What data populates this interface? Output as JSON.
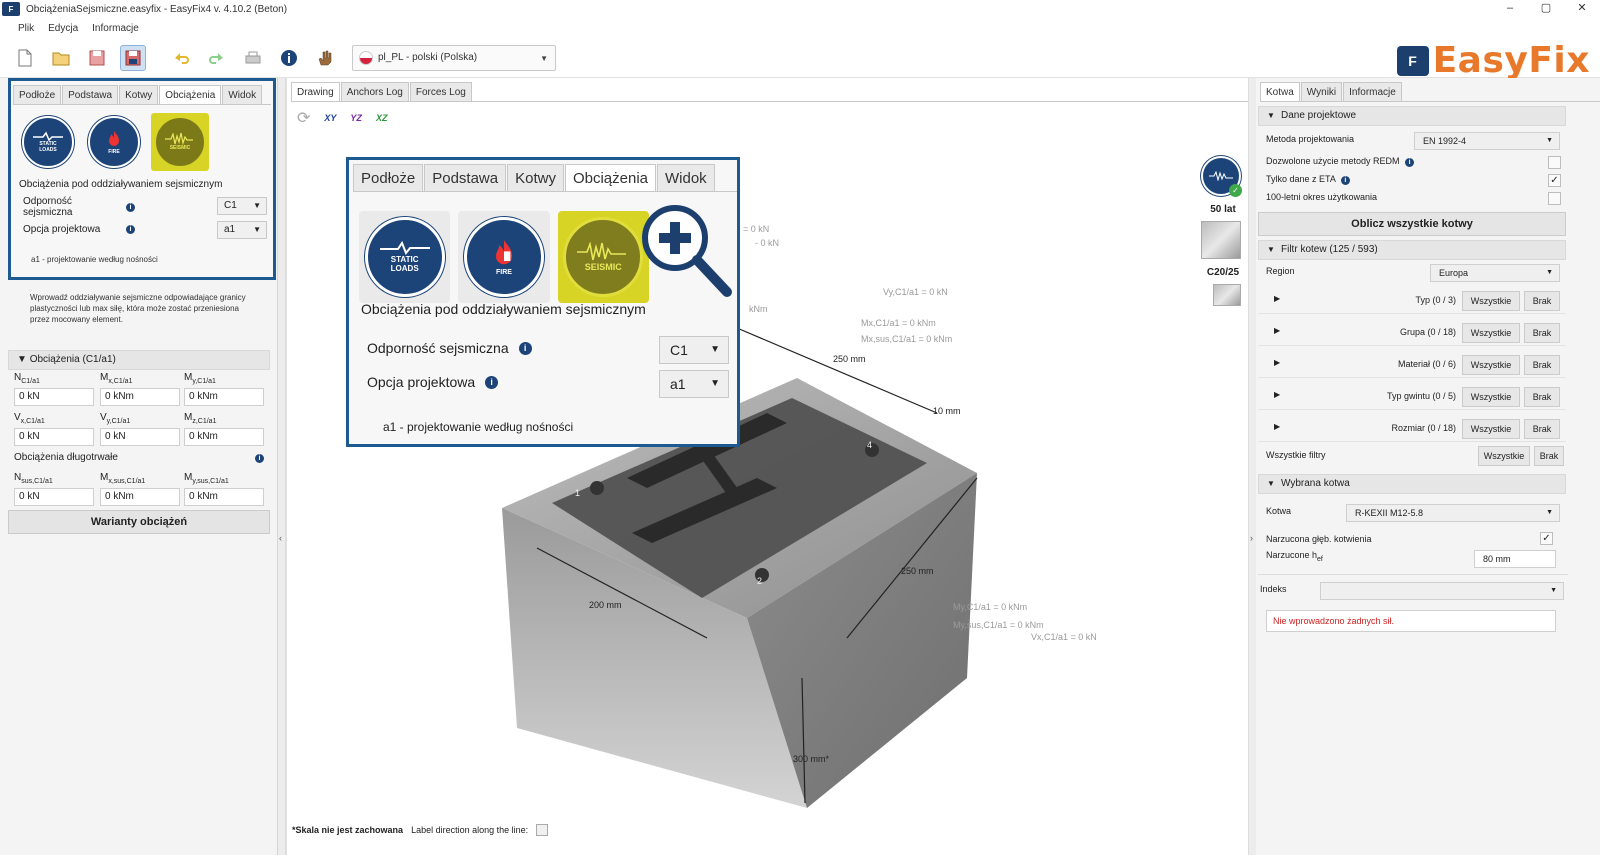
{
  "window": {
    "title": "ObciążeniaSejsmiczne.easyfix - EasyFix4 v. 4.10.2 (Beton)",
    "controls": [
      "–",
      "▢",
      "✕"
    ]
  },
  "menu": [
    "Plik",
    "Edycja",
    "Informacje"
  ],
  "toolbar": {
    "language": "pl_PL - polski (Polska)",
    "icons": [
      "new-file-icon",
      "open-folder-icon",
      "save-icon",
      "save-as-icon",
      "undo-icon",
      "redo-icon",
      "print-icon",
      "info-icon",
      "hand-icon"
    ]
  },
  "brand": {
    "mark": "F",
    "word": "EasyFix",
    "color": "#e8782a"
  },
  "left": {
    "tabs": [
      "Podłoże",
      "Podstawa",
      "Kotwy",
      "Obciążenia",
      "Widok"
    ],
    "active_tab": "Obciążenia",
    "icons": [
      {
        "name": "STATIC\nLOADS",
        "label": "STATIC LOADS"
      },
      {
        "name": "FIRE",
        "label": "FIRE"
      },
      {
        "name": "SEISMIC",
        "label": "SEISMIC"
      }
    ],
    "heading": "Obciążenia pod oddziaływaniem sejsmicznym",
    "resistance_label": "Odporność sejsmiczna",
    "resistance_value": "C1",
    "option_label": "Opcja projektowa",
    "option_value": "a1",
    "note": "a1 - projektowanie według nośności",
    "description": "Wprowadź oddziaływanie sejsmiczne odpowiadające granicy plastyczności lub max siłę, która może zostać przeniesiona przez mocowany element.",
    "loads_header": "Obciążenia (C1/a1)",
    "loads": [
      {
        "label": "N",
        "sub": "C1/a1",
        "value": "0 kN"
      },
      {
        "label": "M",
        "sub": "x,C1/a1",
        "value": "0 kNm"
      },
      {
        "label": "M",
        "sub": "y,C1/a1",
        "value": "0 kNm"
      },
      {
        "label": "V",
        "sub": "x,C1/a1",
        "value": "0 kN"
      },
      {
        "label": "V",
        "sub": "y,C1/a1",
        "value": "0 kN"
      },
      {
        "label": "M",
        "sub": "z,C1/a1",
        "value": "0 kNm"
      }
    ],
    "long_term_label": "Obciążenia długotrwałe",
    "long_term": [
      {
        "label": "N",
        "sub": "sus,C1/a1",
        "value": "0 kN"
      },
      {
        "label": "M",
        "sub": "x,sus,C1/a1",
        "value": "0 kNm"
      },
      {
        "label": "M",
        "sub": "y,sus,C1/a1",
        "value": "0 kNm"
      }
    ],
    "variants_button": "Warianty obciążeń"
  },
  "center": {
    "tabs": [
      "Drawing",
      "Anchors Log",
      "Forces Log"
    ],
    "active_tab": "Drawing",
    "axes": [
      "XY",
      "YZ",
      "XZ"
    ],
    "magnified": {
      "tabs": [
        "Podłoże",
        "Podstawa",
        "Kotwy",
        "Obciążenia",
        "Widok"
      ],
      "active_tab": "Obciążenia",
      "heading": "Obciążenia pod oddziaływaniem sejsmicznym",
      "resistance_label": "Odporność sejsmiczna",
      "resistance_value": "C1",
      "option_label": "Opcja projektowa",
      "option_value": "a1",
      "note": "a1 - projektowanie według nośności"
    },
    "badges": {
      "years": "50 lat",
      "concrete": "C20/25"
    },
    "dimensions": {
      "top": "250 mm",
      "right": "250 mm",
      "front": "200 mm",
      "thickness": "10 mm",
      "depth": "300 mm*"
    },
    "anchor_ids": [
      "1",
      "2",
      "4"
    ],
    "force_labels": {
      "a": "Vy,C1/a1 = 0 kN",
      "b": "Mx,C1/a1 = 0 kNm",
      "c": "Mx,sus,C1/a1 = 0 kNm",
      "d": "My,C1/a1 = 0 kNm",
      "e": "My,sus,C1/a1 = 0 kNm",
      "f": "Vx,C1/a1 = 0 kN",
      "g": "- 0 kN",
      "h": "= 0 kN",
      "i": "kNm"
    },
    "footer_scale": "*Skala nie jest zachowana",
    "footer_label": "Label direction along the line:"
  },
  "right": {
    "tabs": [
      "Kotwa",
      "Wyniki",
      "Informacje"
    ],
    "active_tab": "Kotwa",
    "project_header": "Dane projektowe",
    "method_label": "Metoda projektowania",
    "method_value": "EN 1992-4",
    "redm_label": "Dozwolone użycie metody REDM",
    "eta_label": "Tylko dane z ETA",
    "years_label": "100-letni okres użytkowania",
    "calc_button": "Oblicz wszystkie kotwy",
    "filter_header": "Filtr kotew (125 / 593)",
    "region_label": "Region",
    "region_value": "Europa",
    "filters": [
      "Typ (0 / 3)",
      "Grupa (0 / 18)",
      "Materiał (0 / 6)",
      "Typ gwintu (0 / 5)",
      "Rozmiar (0 / 18)"
    ],
    "all_label": "Wszystkie",
    "none_label": "Brak",
    "all_filters_label": "Wszystkie filtry",
    "selected_header": "Wybrana kotwa",
    "anchor_label": "Kotwa",
    "anchor_value": "R-KEXII M12-5.8",
    "depth_label": "Narzucona głęb. kotwienia",
    "hef_label": "Narzucone h",
    "hef_sub": "ef",
    "hef_value": "80 mm",
    "index_label": "Indeks",
    "error": "Nie wprowadzono żadnych sił."
  }
}
